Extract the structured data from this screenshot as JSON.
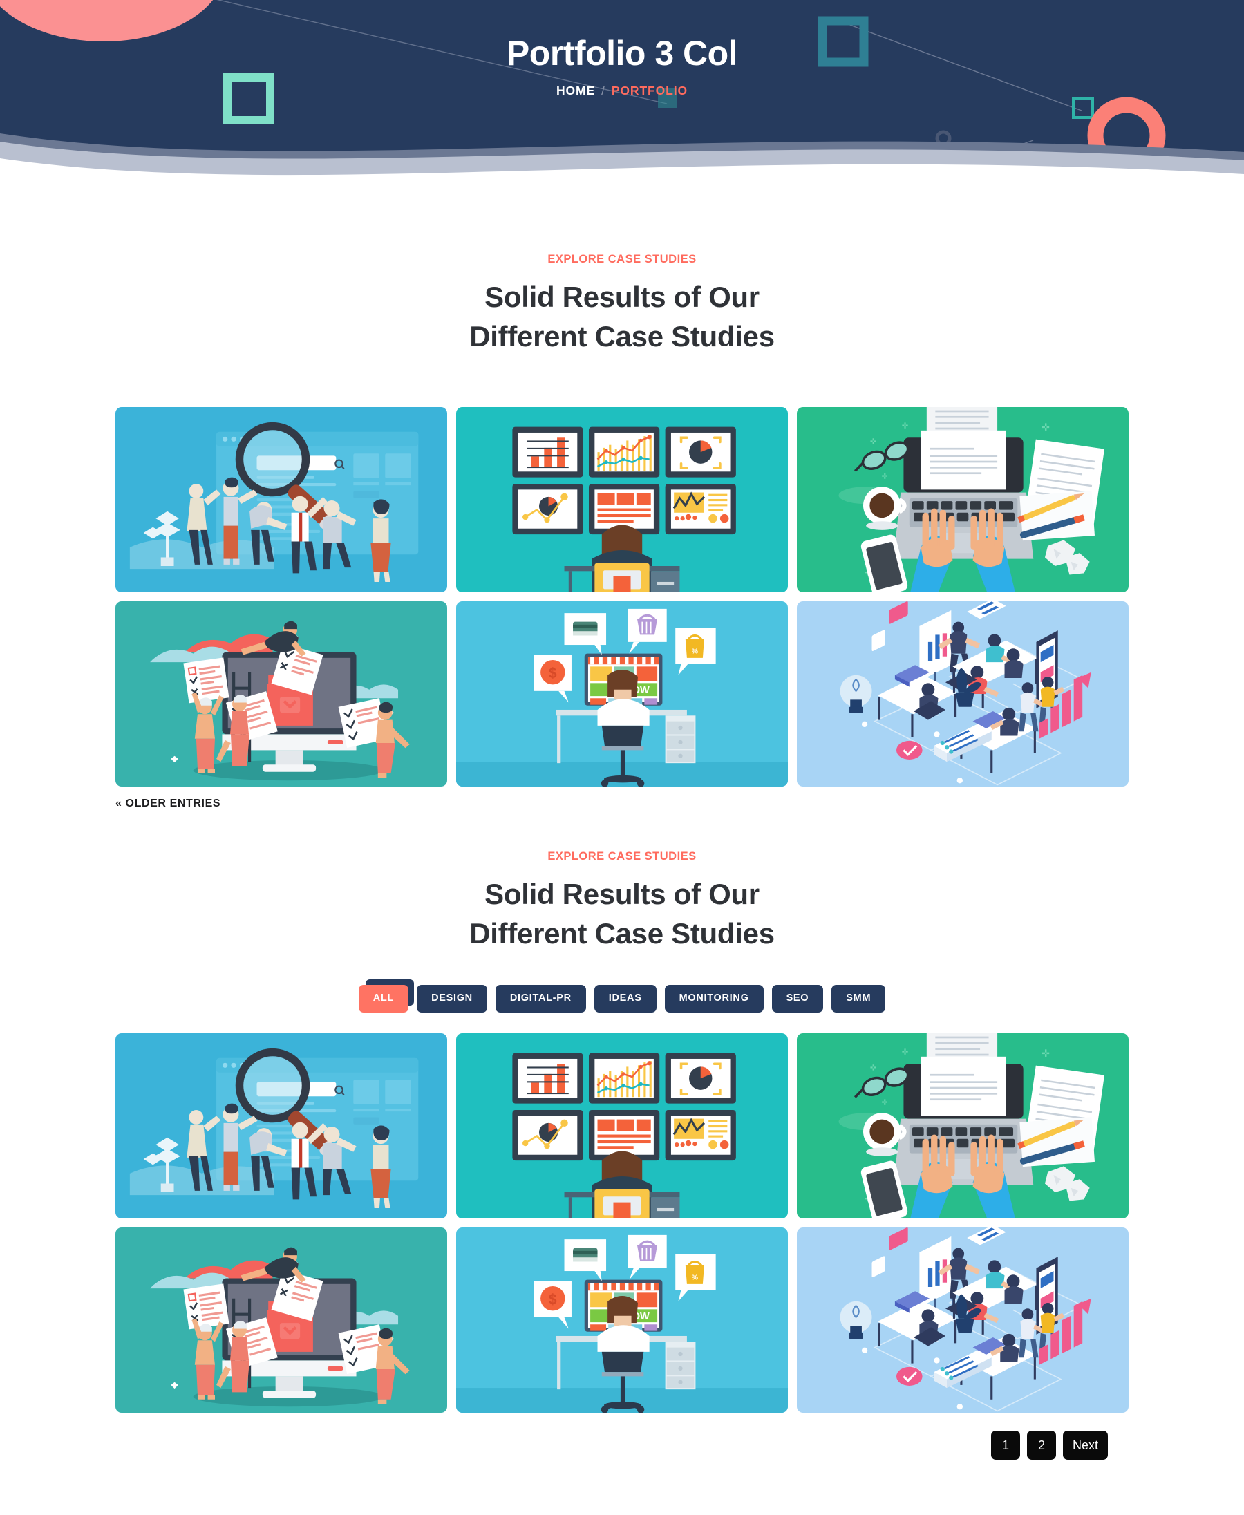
{
  "hero": {
    "title": "Portfolio 3 Col",
    "breadcrumb": {
      "home": "HOME",
      "separator": "/",
      "current": "PORTFOLIO"
    },
    "colors": {
      "background": "#263b5e",
      "accent": "#ff6b5e",
      "mint": "#7fe0c8",
      "teal": "#2f7f94",
      "wave_dark": "#6b7893",
      "wave_light": "#b9c0d0"
    }
  },
  "sections": [
    {
      "eyebrow": "EXPLORE CASE STUDIES",
      "title_line1": "Solid Results of Our",
      "title_line2": "Different Case Studies",
      "older_entries_label": "« OLDER ENTRIES"
    },
    {
      "eyebrow": "EXPLORE CASE STUDIES",
      "title_line1": "Solid Results of Our",
      "title_line2": "Different Case Studies"
    }
  ],
  "filters": {
    "items": [
      {
        "label": "ALL",
        "active": true
      },
      {
        "label": "DESIGN",
        "active": false
      },
      {
        "label": "DIGITAL-PR",
        "active": false
      },
      {
        "label": "IDEAS",
        "active": false
      },
      {
        "label": "MONITORING",
        "active": false
      },
      {
        "label": "SEO",
        "active": false
      },
      {
        "label": "SMM",
        "active": false
      }
    ],
    "active_color": "#ff7363",
    "inactive_color": "#263b5e"
  },
  "portfolio": {
    "items": [
      {
        "id": "seo-search",
        "name": "seo-search-illustration",
        "bg": "#3bb3d9"
      },
      {
        "id": "analytics-wall",
        "name": "analytics-dashboard-illustration",
        "bg": "#1fbfbf"
      },
      {
        "id": "content-writing",
        "name": "content-writing-illustration",
        "bg": "#28bd8b"
      },
      {
        "id": "survey-checklist",
        "name": "survey-checklist-illustration",
        "bg": "#38b2ac"
      },
      {
        "id": "ecommerce-shop",
        "name": "ecommerce-shopping-illustration",
        "bg": "#4cc3e0"
      },
      {
        "id": "isometric-office",
        "name": "isometric-office-illustration",
        "bg": "#a8d4f5"
      }
    ]
  },
  "pagination": {
    "pages": [
      {
        "label": "1",
        "current": true
      },
      {
        "label": "2",
        "current": false
      },
      {
        "label": "Next",
        "current": false
      }
    ]
  }
}
